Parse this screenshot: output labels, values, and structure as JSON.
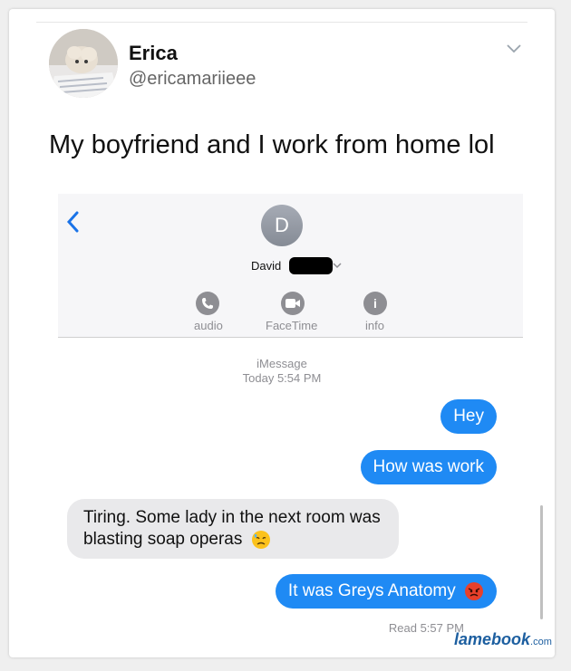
{
  "tweet": {
    "author_name": "Erica",
    "author_handle": "@ericamariieee",
    "text": "My boyfriend and I work from home lol"
  },
  "screenshot": {
    "contact_initial": "D",
    "contact_name": "David",
    "actions": [
      {
        "label": "audio",
        "icon": "phone-icon"
      },
      {
        "label": "FaceTime",
        "icon": "video-icon"
      },
      {
        "label": "info",
        "icon": "info-icon"
      }
    ],
    "service": "iMessage",
    "timestamp": "Today 5:54 PM",
    "messages": [
      {
        "from": "me",
        "text": "Hey"
      },
      {
        "from": "me",
        "text": "How was work"
      },
      {
        "from": "them",
        "text": "Tiring. Some lady in the next room was blasting soap operas",
        "emoji": "sad-sweat-emoji"
      },
      {
        "from": "me",
        "text": "It was Greys Anatomy",
        "emoji": "angry-face-emoji"
      }
    ],
    "read_receipt": "Read 5:57 PM"
  },
  "watermark": {
    "brand": "lamebook",
    "suffix": ".com"
  },
  "colors": {
    "outgoing_bubble": "#1f8af4",
    "incoming_bubble": "#e9e9eb",
    "ios_blue": "#1a73e8"
  }
}
